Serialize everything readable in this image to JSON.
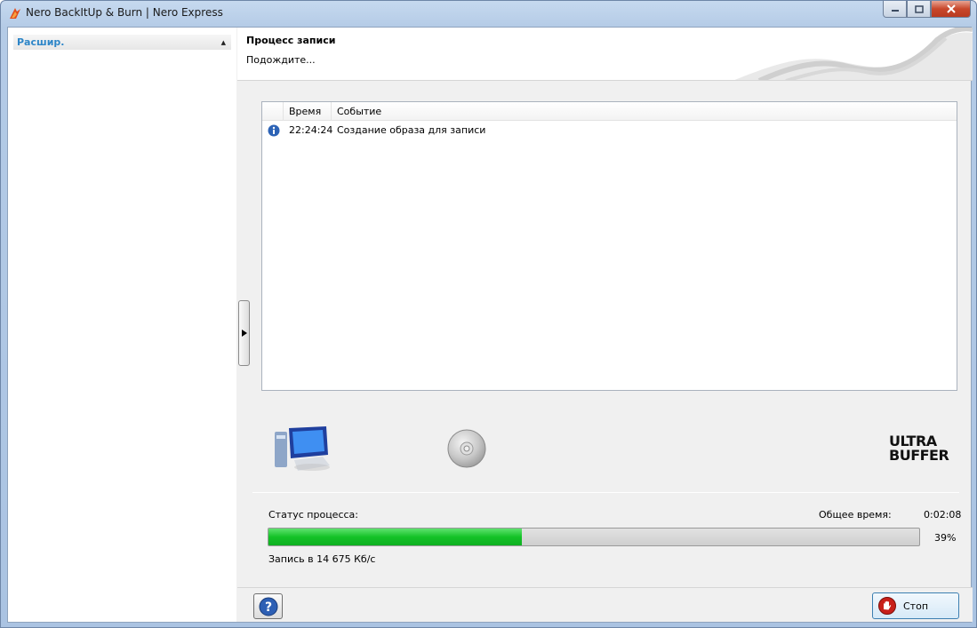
{
  "window": {
    "title": "Nero BackItUp & Burn | Nero Express"
  },
  "sidebar": {
    "section_label": "Расшир."
  },
  "header": {
    "title": "Процесс записи",
    "subtitle": "Подождите..."
  },
  "log": {
    "columns": [
      "",
      "Время",
      "Событие"
    ],
    "rows": [
      {
        "icon": "info-icon",
        "time": "22:24:24",
        "event": "Создание образа для записи"
      }
    ]
  },
  "status": {
    "status_label": "Статус процесса:",
    "total_time_label": "Общее время:",
    "total_time_value": "0:02:08",
    "progress_percent": 39,
    "progress_text": "39%",
    "speed_text": "Запись в 14 675 Кб/с"
  },
  "footer": {
    "stop_label": "Стоп"
  },
  "colors": {
    "accent": "#2e86c8",
    "progress": "#14c227"
  },
  "icons": [
    "nero-app-icon",
    "computer-icon",
    "disc-icon",
    "ultrabuffer-logo",
    "help-icon",
    "stop-hand-icon"
  ]
}
